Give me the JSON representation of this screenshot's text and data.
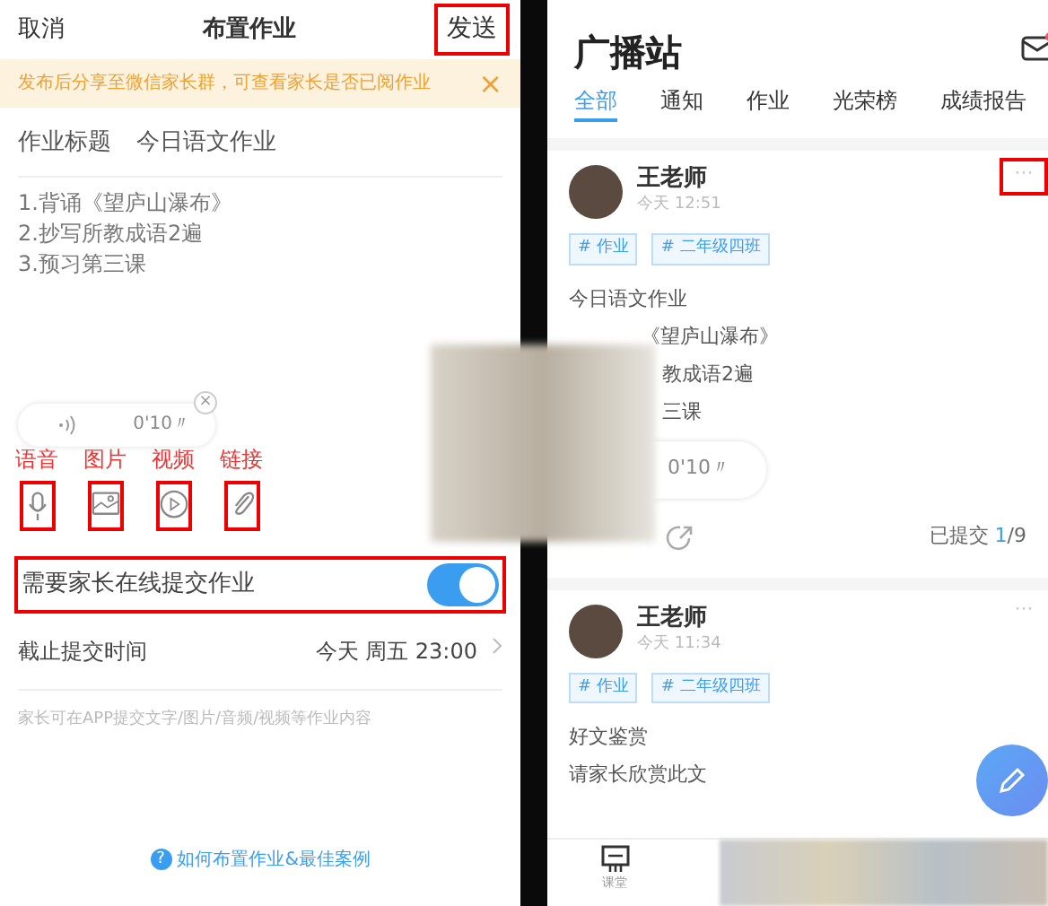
{
  "left": {
    "header": {
      "cancel": "取消",
      "title": "布置作业",
      "send": "发送"
    },
    "banner": {
      "text": "发布后分享至微信家长群，可查看家长是否已阅作业",
      "close": "×"
    },
    "title_row": {
      "label": "作业标题",
      "value": "今日语文作业"
    },
    "content": [
      "1.背诵《望庐山瀑布》",
      "2.抄写所教成语2遍",
      "3.预习第三课"
    ],
    "voice": {
      "duration": "0'10〃",
      "remove": "×"
    },
    "attachments": [
      {
        "kind": "voice",
        "label": "语音"
      },
      {
        "kind": "image",
        "label": "图片"
      },
      {
        "kind": "video",
        "label": "视频"
      },
      {
        "kind": "link",
        "label": "链接"
      }
    ],
    "online_submit": {
      "label": "需要家长在线提交作业",
      "on": true
    },
    "deadline": {
      "label": "截止提交时间",
      "value": "今天 周五 23:00"
    },
    "hint": "家长可在APP提交文字/图片/音频/视频等作业内容",
    "help_icon": "?",
    "help_link": "如何布置作业&最佳案例"
  },
  "right": {
    "title": "广播站",
    "tabs": [
      {
        "label": "全部",
        "selected": true
      },
      {
        "label": "通知",
        "selected": false
      },
      {
        "label": "作业",
        "selected": false
      },
      {
        "label": "光荣榜",
        "selected": false
      },
      {
        "label": "成绩报告",
        "selected": false
      }
    ],
    "posts": [
      {
        "author": "王老师",
        "time": "今天 12:51",
        "tags": [
          "# 作业",
          "# 二年级四班"
        ],
        "lines": [
          "今日语文作业",
          "《望庐山瀑布》",
          "教成语2遍",
          "三课"
        ],
        "menu": "···",
        "voice": "0'10〃",
        "submitted": {
          "label": "已提交",
          "done": "1",
          "total": "/9"
        },
        "menu_highlighted": true
      },
      {
        "author": "王老师",
        "time": "今天 11:34",
        "tags": [
          "# 作业",
          "# 二年级四班"
        ],
        "lines": [
          "好文鉴赏",
          "请家长欣赏此文"
        ],
        "menu": "···",
        "menu_highlighted": false
      }
    ],
    "bottom_tab": "课堂"
  }
}
